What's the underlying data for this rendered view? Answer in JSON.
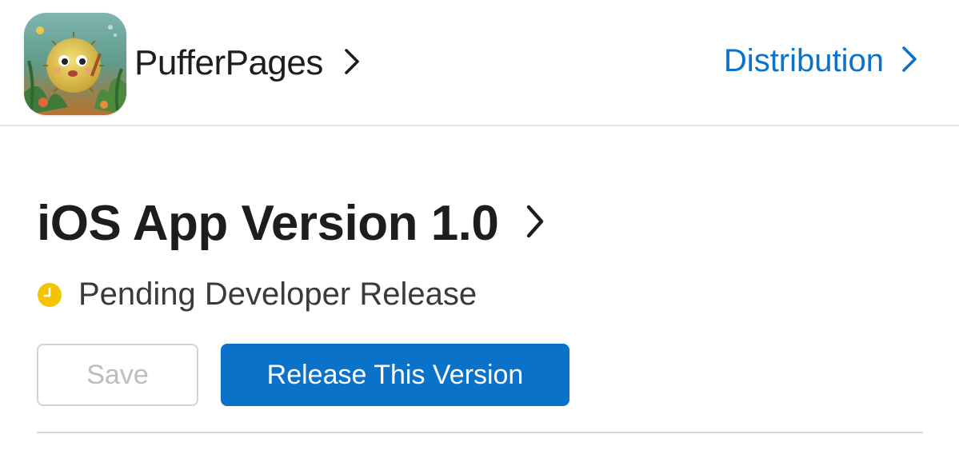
{
  "header": {
    "app_name": "PufferPages",
    "app_icon": "pufferfish-app-icon",
    "distribution_label": "Distribution",
    "link_color": "#0a72c8"
  },
  "version": {
    "title": "iOS App Version 1.0",
    "status_text": "Pending Developer Release",
    "status_icon": "clock-icon",
    "status_color": "#f5c400"
  },
  "actions": {
    "save_label": "Save",
    "save_enabled": false,
    "release_label": "Release This Version",
    "release_color": "#0a72c8"
  }
}
